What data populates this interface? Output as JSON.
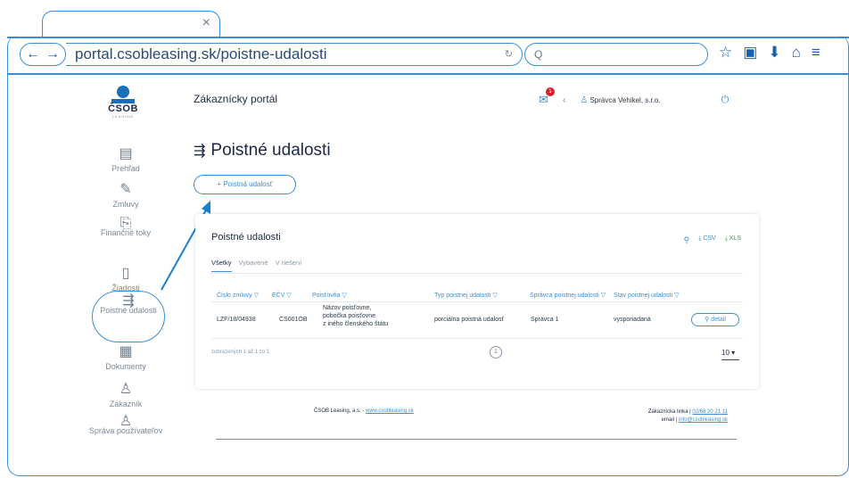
{
  "browser": {
    "url": "portal.csobleasing.sk/poistne-udalosti",
    "tab_close": "×",
    "search_placeholder": "Q"
  },
  "logo": {
    "name": "ČSOB",
    "sub": "LEASING"
  },
  "sidebar": {
    "items": [
      {
        "label": "Prehľad",
        "icon": "overview-icon"
      },
      {
        "label": "Zmluvy",
        "icon": "contract-icon"
      },
      {
        "label": "Finančné toky",
        "icon": "finance-icon"
      },
      {
        "label": "Žiadosti",
        "icon": "document-icon"
      },
      {
        "label": "Poistné udalosti",
        "icon": "insurance-icon"
      },
      {
        "label": "Dokumenty",
        "icon": "documents-icon"
      },
      {
        "label": "Zákazník",
        "icon": "user-icon"
      },
      {
        "label": "Správa používateľov",
        "icon": "users-icon"
      }
    ]
  },
  "header": {
    "title": "Zákaznícky portál",
    "mail_badge": "1",
    "company": "Správca Vehikel, s.r.o."
  },
  "main": {
    "title": "Poistné udalosti",
    "add_button": "+ Poistná udalosť"
  },
  "card": {
    "title": "Poistné udalosti",
    "csv": "CSV",
    "xls": "XLS",
    "tabs": [
      "Všetky",
      "Vybavené",
      "V riešení"
    ],
    "columns": [
      "Číslo zmluvy",
      "EČV",
      "Poisťovňa",
      "Typ poistnej udalosti",
      "Správca poistnej udalosti",
      "Stav poistnej udalosti"
    ],
    "row": {
      "contract": "LZF/18/04938",
      "ecv": "CS001OB",
      "insurer_1": "Názov poisťovne,",
      "insurer_2": "pobočka poisťovne",
      "insurer_3": "z iného členského štátu",
      "type": "porciálna poistná udalosť",
      "manager": "Správca 1",
      "status": "vysporiadaná",
      "detail": "detail"
    },
    "pager_info": "zobrazených 1 až 1 zo 1",
    "page": "1",
    "page_size": "10 ▾"
  },
  "footer": {
    "company": "ČSOB Leasing, a.s. - ",
    "company_link": "www.csobleasing.sk",
    "hotline_label": "Zákaznícka linka | ",
    "hotline": "02/68 20 21 11",
    "email_label": "email | ",
    "email": "info@csobleasing.sk"
  },
  "colors": {
    "accent": "#3a8fd8",
    "brand": "#1a6fb8"
  }
}
